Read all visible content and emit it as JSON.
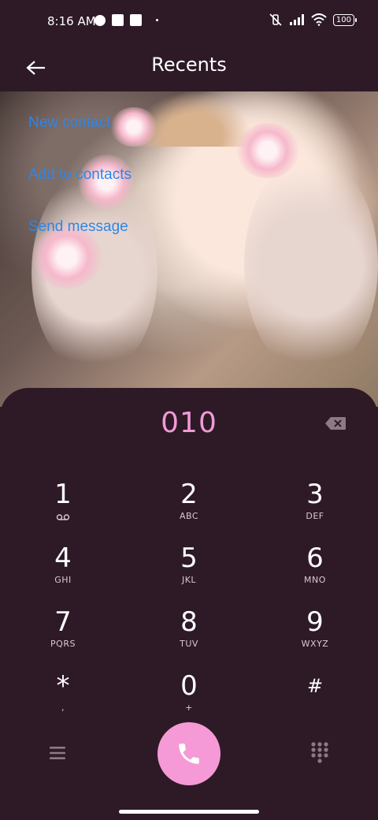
{
  "status": {
    "time": "8:16 AM",
    "battery": "100"
  },
  "header": {
    "title": "Recents"
  },
  "actions": [
    {
      "label": "New contact"
    },
    {
      "label": "Add to contacts"
    },
    {
      "label": "Send message"
    }
  ],
  "dialer": {
    "number": "010",
    "keys": [
      {
        "digit": "1",
        "letters": ""
      },
      {
        "digit": "2",
        "letters": "ABC"
      },
      {
        "digit": "3",
        "letters": "DEF"
      },
      {
        "digit": "4",
        "letters": "GHI"
      },
      {
        "digit": "5",
        "letters": "JKL"
      },
      {
        "digit": "6",
        "letters": "MNO"
      },
      {
        "digit": "7",
        "letters": "PQRS"
      },
      {
        "digit": "8",
        "letters": "TUV"
      },
      {
        "digit": "9",
        "letters": "WXYZ"
      },
      {
        "digit": "*",
        "letters": ","
      },
      {
        "digit": "0",
        "letters": "+"
      },
      {
        "digit": "#",
        "letters": ""
      }
    ]
  },
  "colors": {
    "background": "#2d1a26",
    "accent": "#f59ad6",
    "link": "#2f86e6"
  },
  "icons": {
    "back": "arrow-left-icon",
    "backspace": "backspace-icon",
    "voicemail": "voicemail-icon",
    "menu": "menu-icon",
    "call": "phone-icon",
    "keypad": "dialpad-icon"
  }
}
